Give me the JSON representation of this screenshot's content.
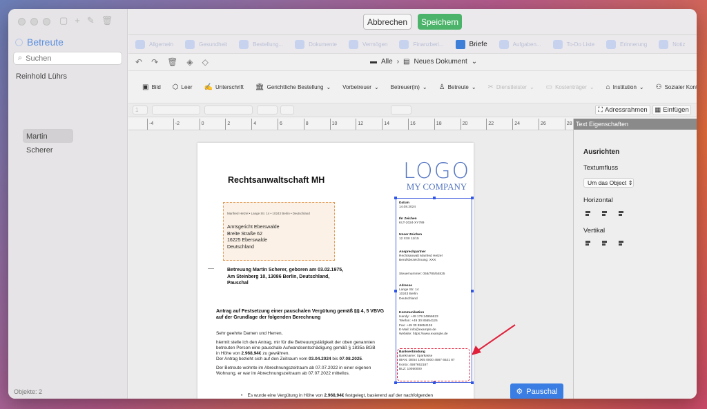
{
  "sidebar": {
    "title": "Betreute",
    "search_placeholder": "Suchen",
    "people": [
      "Reinhold Lührs",
      "Martin Scherer"
    ],
    "selected": "Martin Scherer",
    "object_count": "Objekte: 2"
  },
  "topbar": {
    "cancel": "Abbrechen",
    "save": "Speichern"
  },
  "tabs": [
    {
      "label": "Allgemein",
      "active": false
    },
    {
      "label": "Gesundheit",
      "active": false
    },
    {
      "label": "Bestellung...",
      "active": false
    },
    {
      "label": "Dokumente",
      "active": false
    },
    {
      "label": "Vermögen",
      "active": false
    },
    {
      "label": "Finanzberi...",
      "active": false
    },
    {
      "label": "Briefe",
      "active": true
    },
    {
      "label": "Aufgaben...",
      "active": false
    },
    {
      "label": "To-Do Liste",
      "active": false
    },
    {
      "label": "Erinnerung",
      "active": false
    },
    {
      "label": "Notiz",
      "active": false
    }
  ],
  "breadcrumb": {
    "root": "Alle",
    "doc": "Neues Dokument"
  },
  "format_toolbar": [
    {
      "label": "Bild",
      "icon": "image-icon",
      "disabled": false
    },
    {
      "label": "Leer",
      "icon": "cube-icon",
      "disabled": false
    },
    {
      "label": "Unterschrift",
      "icon": "signature-icon",
      "disabled": false
    },
    {
      "label": "Gerichtliche Bestellung",
      "icon": "court-icon",
      "disabled": false
    },
    {
      "label": "Vorbetreuer",
      "icon": "",
      "disabled": false
    },
    {
      "label": "Betreuer(in)",
      "icon": "",
      "disabled": false
    },
    {
      "label": "Betreute",
      "icon": "person-icon",
      "disabled": false
    },
    {
      "label": "Dienstleister",
      "icon": "tools-icon",
      "disabled": true
    },
    {
      "label": "Kostenträger",
      "icon": "card-icon",
      "disabled": true
    },
    {
      "label": "Institution",
      "icon": "institution-icon",
      "disabled": false
    },
    {
      "label": "Sozialer Kontakt",
      "icon": "people-icon",
      "disabled": false
    }
  ],
  "textbar": {
    "font_size": "1",
    "address_frames": "Adressrahmen",
    "insert": "Einfügen"
  },
  "ruler_ticks": [
    "-4",
    "-2",
    "0",
    "2",
    "4",
    "6",
    "8",
    "10",
    "12",
    "14",
    "16",
    "18",
    "20",
    "22",
    "24",
    "26",
    "28"
  ],
  "document": {
    "firm": "Rechtsanwaltschaft MH",
    "logo_line1": "LOGO",
    "logo_line2": "MY COMPANY",
    "sender_line": "Manfred Hetzel • Lange Str. 14 • 10243 Berlin • Deutschland",
    "recipient": [
      "Amtsgericht Eberswalde",
      "Breite Straße 62",
      "16225 Eberswalde",
      "Deutschland"
    ],
    "subject": [
      "Betreuung Martin Scherer, geboren am 03.02.1975,",
      "Am Steinberg 10, 13086 Berlin, Deutschland,",
      "Pauschal"
    ],
    "request": [
      "Antrag auf Festsetzung einer pauschalen Vergütung gemäß §§ 4, 5 VBVG",
      "auf der Grundlage der folgenden Berechnung"
    ],
    "greeting": "Sehr geehrte Damen und Herren,",
    "para1_a": "hiermit stelle ich den Antrag, mir für die Betreuungstätigkeit der oben genannten",
    "para1_b": "betreuten Person eine pauschale Aufwandsentschädigung gemäß § 1835a BGB",
    "para1_c_pre": "in Höhe von ",
    "para1_c_amount": "2.968,94€",
    "para1_c_post": " zu gewähren.",
    "para2_pre": "Der Antrag bezieht sich auf den Zeitraum vom ",
    "para2_from": "03.04.2024",
    "para2_mid": " bis ",
    "para2_to": "07.08.2025",
    "para2_post": ".",
    "para3_a": "Der Betreute wohnte im Abrechnungszeitraum ab 07.07.2022 in einer eigenen",
    "para3_b": "Wohnung, er war im Abrechnungszeitraum ab 07.07.2022 mittellos.",
    "bullet_pre": "Es wurde eine Vergütung in Höhe von ",
    "bullet_amount": "2.968,94€",
    "bullet_post": " festgelegt, basierend auf der nachfolgenden"
  },
  "info_block": {
    "date_label": "Datum",
    "date": "14.08.2024",
    "your_ref_label": "Ihr Zeichen",
    "your_ref": "KLT-2024-XY789",
    "our_ref_label": "Unser Zeichen",
    "our_ref": "12 XXII 11/15",
    "contact_label": "Ansprechpartner",
    "contact_name": "Rechtsanwalt Manfred Hetzel",
    "contact_title": "Berufsbezeichnung: XXX",
    "tax_no": "Steuernummer: 058/785/54825",
    "address_label": "Adresse",
    "address": [
      "Lange Str. 14",
      "10243 Berlin",
      "Deutschland"
    ],
    "comm_label": "Kommunikation",
    "comm": [
      "Handy: +49 179 24956623",
      "Telefon: +49 30 85654125",
      "Fax: +49 30 85654126",
      "E-Mail: info@example.de",
      "Website: https://www.example.de"
    ],
    "bank_label": "Bankverbindung",
    "bank": [
      "Bankname: Sparkasse",
      "IBAN: DE54 1005 0000 4587 6521 87",
      "Konto: 4587652187",
      "BLZ: 10050000"
    ]
  },
  "floating_button": "Pauschal",
  "panel": {
    "header": "Text Eigenschaften",
    "align_title": "Ausrichten",
    "textflow_label": "Textumfluss",
    "textflow_value": "Um das Object",
    "horizontal_label": "Horizontal",
    "vertical_label": "Vertikal"
  },
  "colors": {
    "accent": "#3a7ee4",
    "save": "#4bb46a",
    "highlight": "#e0203a"
  }
}
